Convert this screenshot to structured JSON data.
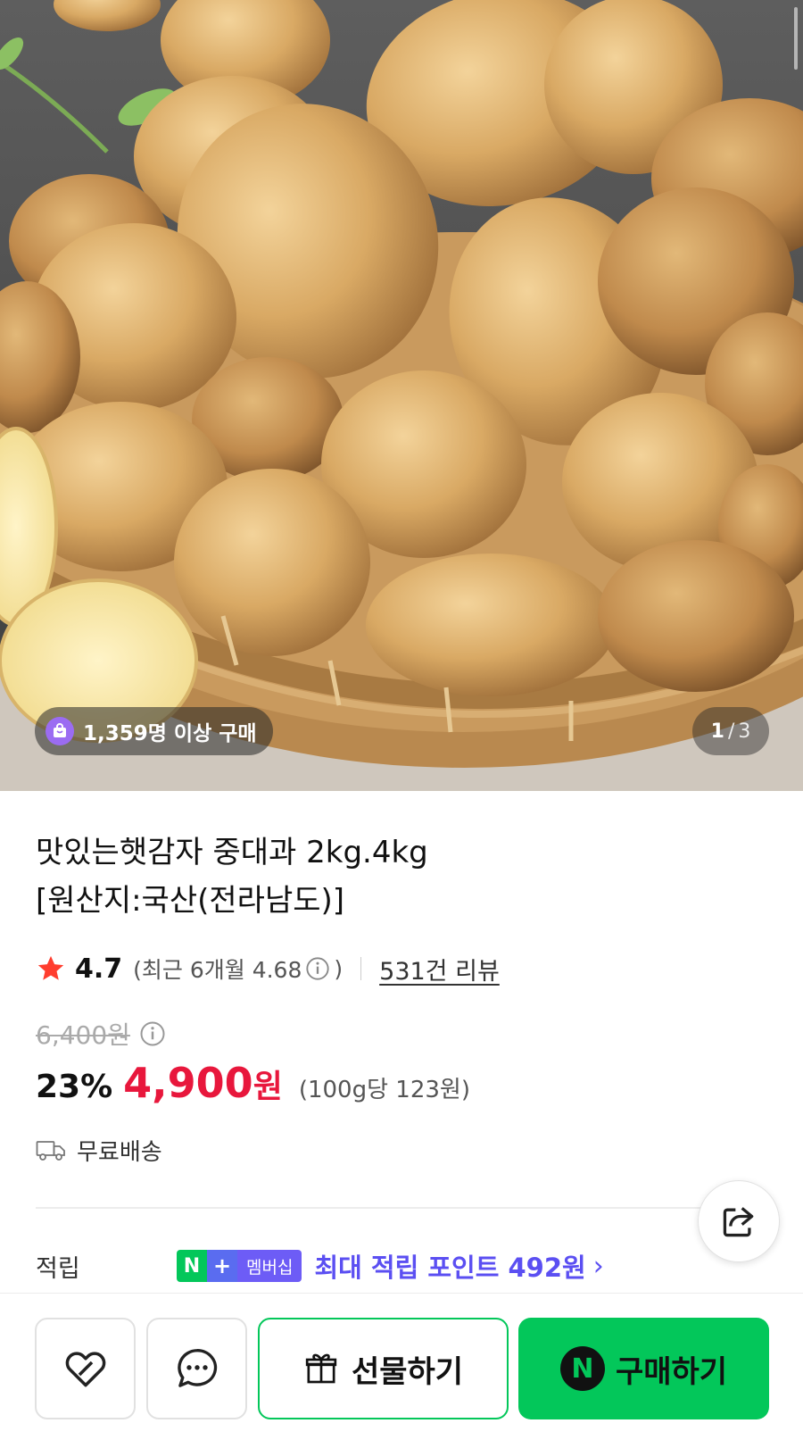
{
  "hero": {
    "image_icon": "potato-basket-photo",
    "buyers_badge": "1,359명 이상 구매",
    "counter": {
      "current": "1",
      "separator": "/",
      "total": "3"
    }
  },
  "product": {
    "title_line1": "맛있는햇감자 중대과 2kg.4kg",
    "title_line2": "[원산지:국산(전라남도)]",
    "rating": "4.7",
    "recent_rating_prefix": "(최근 6개월 4.68",
    "recent_rating_suffix": ")",
    "review_link": "531건 리뷰",
    "original_price": "6,400원",
    "discount": "23%",
    "sale_price": "4,900",
    "sale_currency": "원",
    "unit_price": "(100g당 123원)",
    "shipping": "무료배송"
  },
  "points": {
    "label": "적립",
    "badge_n": "N",
    "badge_plus": "+",
    "badge_membership": "멤버십",
    "text": "최대 적립 포인트 492원",
    "chevron": "›"
  },
  "bottom_bar": {
    "gift_label": "선물하기",
    "buy_label": "구매하기",
    "buy_n": "N"
  },
  "colors": {
    "accent_green": "#03c75a",
    "sale_red": "#e8173c",
    "points_purple": "#5b4ff2",
    "star_red": "#ff3d2e"
  },
  "icons": [
    "shopping-bag-icon",
    "star-icon",
    "info-icon",
    "truck-icon",
    "share-icon",
    "heart-icon",
    "chat-icon",
    "gift-icon"
  ]
}
